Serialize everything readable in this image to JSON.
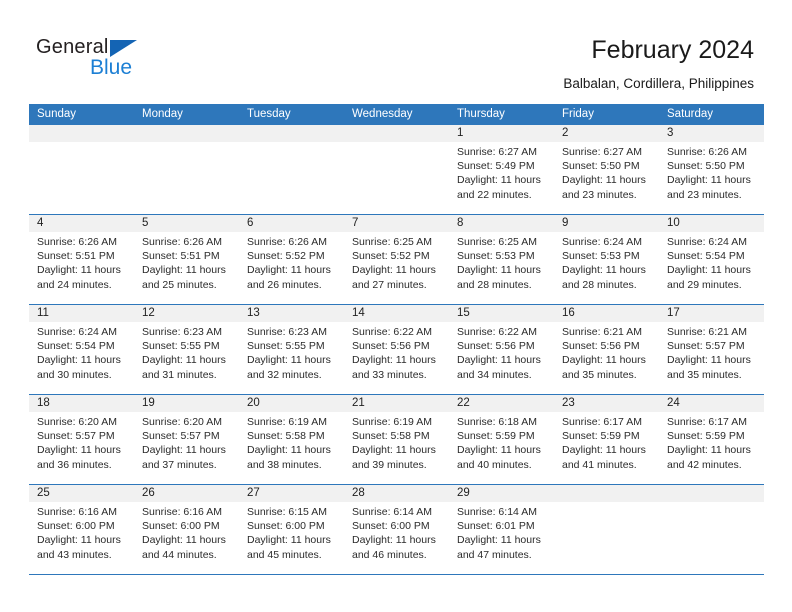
{
  "brand": {
    "name_top": "General",
    "name_bottom": "Blue",
    "triangle_icon": "triangle-icon",
    "accent_color": "#1c7fd4"
  },
  "header": {
    "title": "February 2024",
    "location": "Balbalan, Cordillera, Philippines"
  },
  "theme": {
    "header_blue": "#2e77bb",
    "date_band": "#f1f1f1",
    "text": "#2b2b2b"
  },
  "weekdays": [
    "Sunday",
    "Monday",
    "Tuesday",
    "Wednesday",
    "Thursday",
    "Friday",
    "Saturday"
  ],
  "weeks": [
    {
      "days": [
        {
          "date": "",
          "lines": []
        },
        {
          "date": "",
          "lines": []
        },
        {
          "date": "",
          "lines": []
        },
        {
          "date": "",
          "lines": []
        },
        {
          "date": "1",
          "lines": [
            "Sunrise: 6:27 AM",
            "Sunset: 5:49 PM",
            "Daylight: 11 hours",
            "and 22 minutes."
          ]
        },
        {
          "date": "2",
          "lines": [
            "Sunrise: 6:27 AM",
            "Sunset: 5:50 PM",
            "Daylight: 11 hours",
            "and 23 minutes."
          ]
        },
        {
          "date": "3",
          "lines": [
            "Sunrise: 6:26 AM",
            "Sunset: 5:50 PM",
            "Daylight: 11 hours",
            "and 23 minutes."
          ]
        }
      ]
    },
    {
      "days": [
        {
          "date": "4",
          "lines": [
            "Sunrise: 6:26 AM",
            "Sunset: 5:51 PM",
            "Daylight: 11 hours",
            "and 24 minutes."
          ]
        },
        {
          "date": "5",
          "lines": [
            "Sunrise: 6:26 AM",
            "Sunset: 5:51 PM",
            "Daylight: 11 hours",
            "and 25 minutes."
          ]
        },
        {
          "date": "6",
          "lines": [
            "Sunrise: 6:26 AM",
            "Sunset: 5:52 PM",
            "Daylight: 11 hours",
            "and 26 minutes."
          ]
        },
        {
          "date": "7",
          "lines": [
            "Sunrise: 6:25 AM",
            "Sunset: 5:52 PM",
            "Daylight: 11 hours",
            "and 27 minutes."
          ]
        },
        {
          "date": "8",
          "lines": [
            "Sunrise: 6:25 AM",
            "Sunset: 5:53 PM",
            "Daylight: 11 hours",
            "and 28 minutes."
          ]
        },
        {
          "date": "9",
          "lines": [
            "Sunrise: 6:24 AM",
            "Sunset: 5:53 PM",
            "Daylight: 11 hours",
            "and 28 minutes."
          ]
        },
        {
          "date": "10",
          "lines": [
            "Sunrise: 6:24 AM",
            "Sunset: 5:54 PM",
            "Daylight: 11 hours",
            "and 29 minutes."
          ]
        }
      ]
    },
    {
      "days": [
        {
          "date": "11",
          "lines": [
            "Sunrise: 6:24 AM",
            "Sunset: 5:54 PM",
            "Daylight: 11 hours",
            "and 30 minutes."
          ]
        },
        {
          "date": "12",
          "lines": [
            "Sunrise: 6:23 AM",
            "Sunset: 5:55 PM",
            "Daylight: 11 hours",
            "and 31 minutes."
          ]
        },
        {
          "date": "13",
          "lines": [
            "Sunrise: 6:23 AM",
            "Sunset: 5:55 PM",
            "Daylight: 11 hours",
            "and 32 minutes."
          ]
        },
        {
          "date": "14",
          "lines": [
            "Sunrise: 6:22 AM",
            "Sunset: 5:56 PM",
            "Daylight: 11 hours",
            "and 33 minutes."
          ]
        },
        {
          "date": "15",
          "lines": [
            "Sunrise: 6:22 AM",
            "Sunset: 5:56 PM",
            "Daylight: 11 hours",
            "and 34 minutes."
          ]
        },
        {
          "date": "16",
          "lines": [
            "Sunrise: 6:21 AM",
            "Sunset: 5:56 PM",
            "Daylight: 11 hours",
            "and 35 minutes."
          ]
        },
        {
          "date": "17",
          "lines": [
            "Sunrise: 6:21 AM",
            "Sunset: 5:57 PM",
            "Daylight: 11 hours",
            "and 35 minutes."
          ]
        }
      ]
    },
    {
      "days": [
        {
          "date": "18",
          "lines": [
            "Sunrise: 6:20 AM",
            "Sunset: 5:57 PM",
            "Daylight: 11 hours",
            "and 36 minutes."
          ]
        },
        {
          "date": "19",
          "lines": [
            "Sunrise: 6:20 AM",
            "Sunset: 5:57 PM",
            "Daylight: 11 hours",
            "and 37 minutes."
          ]
        },
        {
          "date": "20",
          "lines": [
            "Sunrise: 6:19 AM",
            "Sunset: 5:58 PM",
            "Daylight: 11 hours",
            "and 38 minutes."
          ]
        },
        {
          "date": "21",
          "lines": [
            "Sunrise: 6:19 AM",
            "Sunset: 5:58 PM",
            "Daylight: 11 hours",
            "and 39 minutes."
          ]
        },
        {
          "date": "22",
          "lines": [
            "Sunrise: 6:18 AM",
            "Sunset: 5:59 PM",
            "Daylight: 11 hours",
            "and 40 minutes."
          ]
        },
        {
          "date": "23",
          "lines": [
            "Sunrise: 6:17 AM",
            "Sunset: 5:59 PM",
            "Daylight: 11 hours",
            "and 41 minutes."
          ]
        },
        {
          "date": "24",
          "lines": [
            "Sunrise: 6:17 AM",
            "Sunset: 5:59 PM",
            "Daylight: 11 hours",
            "and 42 minutes."
          ]
        }
      ]
    },
    {
      "days": [
        {
          "date": "25",
          "lines": [
            "Sunrise: 6:16 AM",
            "Sunset: 6:00 PM",
            "Daylight: 11 hours",
            "and 43 minutes."
          ]
        },
        {
          "date": "26",
          "lines": [
            "Sunrise: 6:16 AM",
            "Sunset: 6:00 PM",
            "Daylight: 11 hours",
            "and 44 minutes."
          ]
        },
        {
          "date": "27",
          "lines": [
            "Sunrise: 6:15 AM",
            "Sunset: 6:00 PM",
            "Daylight: 11 hours",
            "and 45 minutes."
          ]
        },
        {
          "date": "28",
          "lines": [
            "Sunrise: 6:14 AM",
            "Sunset: 6:00 PM",
            "Daylight: 11 hours",
            "and 46 minutes."
          ]
        },
        {
          "date": "29",
          "lines": [
            "Sunrise: 6:14 AM",
            "Sunset: 6:01 PM",
            "Daylight: 11 hours",
            "and 47 minutes."
          ]
        },
        {
          "date": "",
          "lines": []
        },
        {
          "date": "",
          "lines": []
        }
      ]
    }
  ]
}
